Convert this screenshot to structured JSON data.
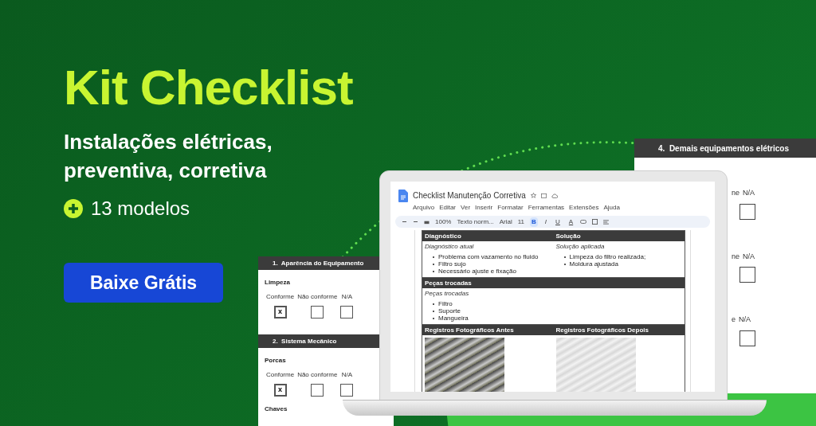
{
  "headline": "Kit Checklist",
  "subtitle": "Instalações elétricas, preventiva, corretiva",
  "models_badge": "13 modelos",
  "cta_button": "Baixe Grátis",
  "left_sheet": {
    "sections": [
      {
        "title": "1.  Aparência do Equipamento",
        "item": "Limpeza",
        "options": [
          {
            "label": "Conforme",
            "checked": true,
            "mark": "x"
          },
          {
            "label": "Não conforme",
            "checked": false
          },
          {
            "label": "N/A",
            "checked": false
          }
        ]
      },
      {
        "title": "2.  Sistema Mecânico",
        "item": "Porcas",
        "options": [
          {
            "label": "Conforme",
            "checked": true,
            "mark": "x"
          },
          {
            "label": "Não conforme",
            "checked": false
          },
          {
            "label": "N/A",
            "checked": false
          }
        ]
      }
    ],
    "next_item": "Chaves"
  },
  "right_sheet": {
    "title": "4.  Demais equipamentos elétricos",
    "rows": [
      {
        "label_fragment": "ne",
        "na_label": "N/A",
        "checked": false
      },
      {
        "label_fragment": "ne",
        "na_label": "N/A",
        "checked": false
      },
      {
        "label_fragment": "e",
        "na_label": "N/A",
        "checked": false
      }
    ]
  },
  "document": {
    "title": "Checklist Manutenção Corretiva",
    "menu": [
      "Arquivo",
      "Editar",
      "Ver",
      "Inserir",
      "Formatar",
      "Ferramentas",
      "Extensões",
      "Ajuda"
    ],
    "toolbar": {
      "zoom": "100%",
      "style": "Texto norm...",
      "font": "Arial",
      "font_size": "11",
      "format_buttons": [
        {
          "label": "B",
          "selected": true
        },
        {
          "label": "I",
          "selected": false
        },
        {
          "label": "U",
          "selected": false
        },
        {
          "label": "A",
          "selected": false
        }
      ]
    },
    "table": [
      {
        "kind": "header",
        "cells": [
          "Diagnóstico",
          "Solução"
        ]
      },
      {
        "kind": "content",
        "cells": [
          {
            "caption": "Diagnóstico atual",
            "bullets": [
              "Problema com vazamento no fluido",
              "Filtro sujo",
              "Necessário ajuste e fixação"
            ]
          },
          {
            "caption": "Solução aplicada",
            "bullets": [
              "Limpeza do filtro realizada;",
              "Moldura ajustada"
            ]
          }
        ]
      },
      {
        "kind": "header",
        "cells": [
          "Peças trocadas"
        ]
      },
      {
        "kind": "content",
        "cells": [
          {
            "caption": "Peças trocadas",
            "bullets": [
              "Filtro",
              "Suporte",
              "Mangueira"
            ]
          }
        ]
      },
      {
        "kind": "header",
        "cells": [
          "Registros Fotográficos Antes",
          "Registros Fotográficos Depois"
        ]
      },
      {
        "kind": "photos",
        "cells": [
          {
            "kind": "photo"
          },
          {
            "kind": "photo"
          }
        ]
      }
    ]
  }
}
